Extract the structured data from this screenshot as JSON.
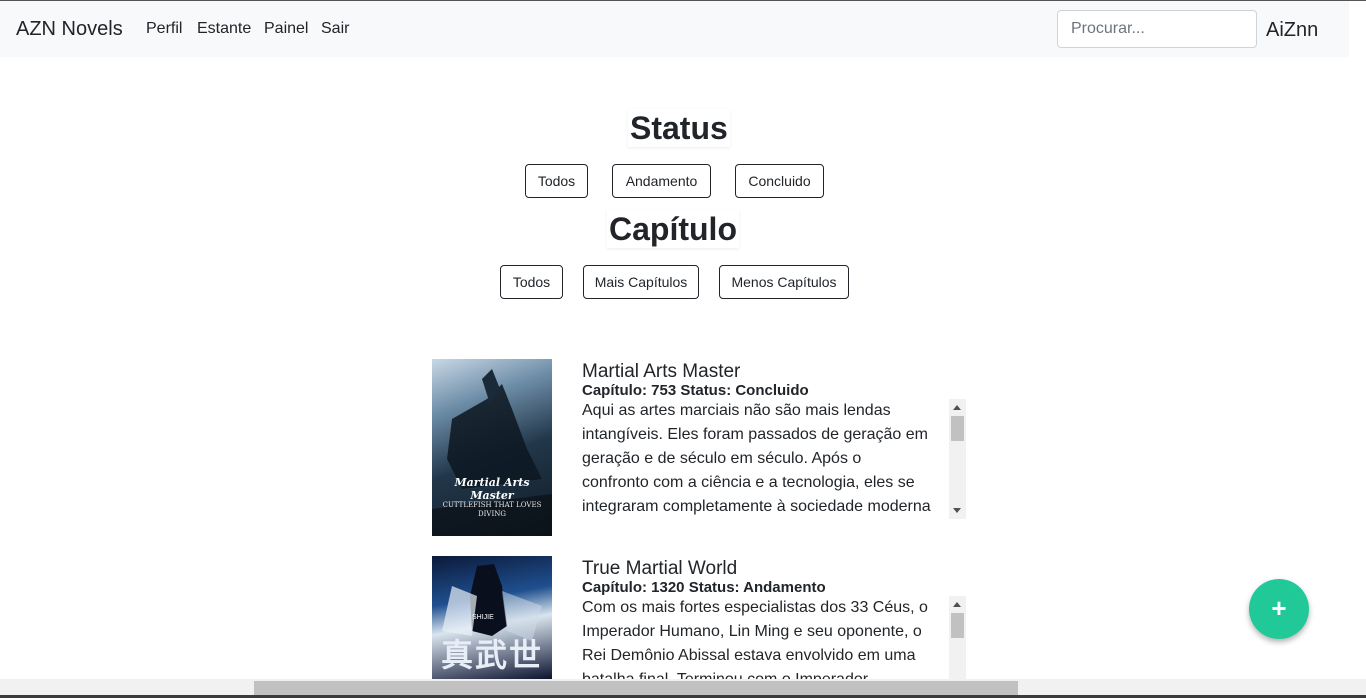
{
  "navbar": {
    "brand": "AZN Novels",
    "links": [
      "Perfil",
      "Estante",
      "Painel",
      "Sair"
    ],
    "search_placeholder": "Procurar...",
    "user": "AiZnn"
  },
  "filters": {
    "status": {
      "heading": "Status",
      "buttons": [
        "Todos",
        "Andamento",
        "Concluido"
      ]
    },
    "chapter": {
      "heading": "Capítulo",
      "buttons": [
        "Todos",
        "Mais Capítulos",
        "Menos Capítulos"
      ]
    }
  },
  "novels": [
    {
      "title": "Martial Arts Master",
      "meta": "Capítulo: 753 Status: Concluido",
      "description": "Aqui as artes marciais não são mais lendas intangíveis. Eles foram passados de geração em geração e de século em século. Após o confronto com a ciência e a tecnologia, eles se integraram completamente à sociedade moderna e todos os",
      "cover": {
        "title": "Martial Arts Master",
        "subtitle": "CUTTLEFISH THAT LOVES DIVING"
      }
    },
    {
      "title": "True Martial World",
      "meta": "Capítulo: 1320 Status: Andamento",
      "description": "Com os mais fortes especialistas dos 33 Céus, o Imperador Humano, Lin Ming e seu oponente, o Rei Demônio Abissal estava envolvido em uma batalha final. Terminou com o Imperador",
      "cover": {
        "title": "真武世界",
        "subtitle": "SHIJIE"
      }
    }
  ],
  "fab": {
    "label": "+",
    "color": "#20c997"
  }
}
